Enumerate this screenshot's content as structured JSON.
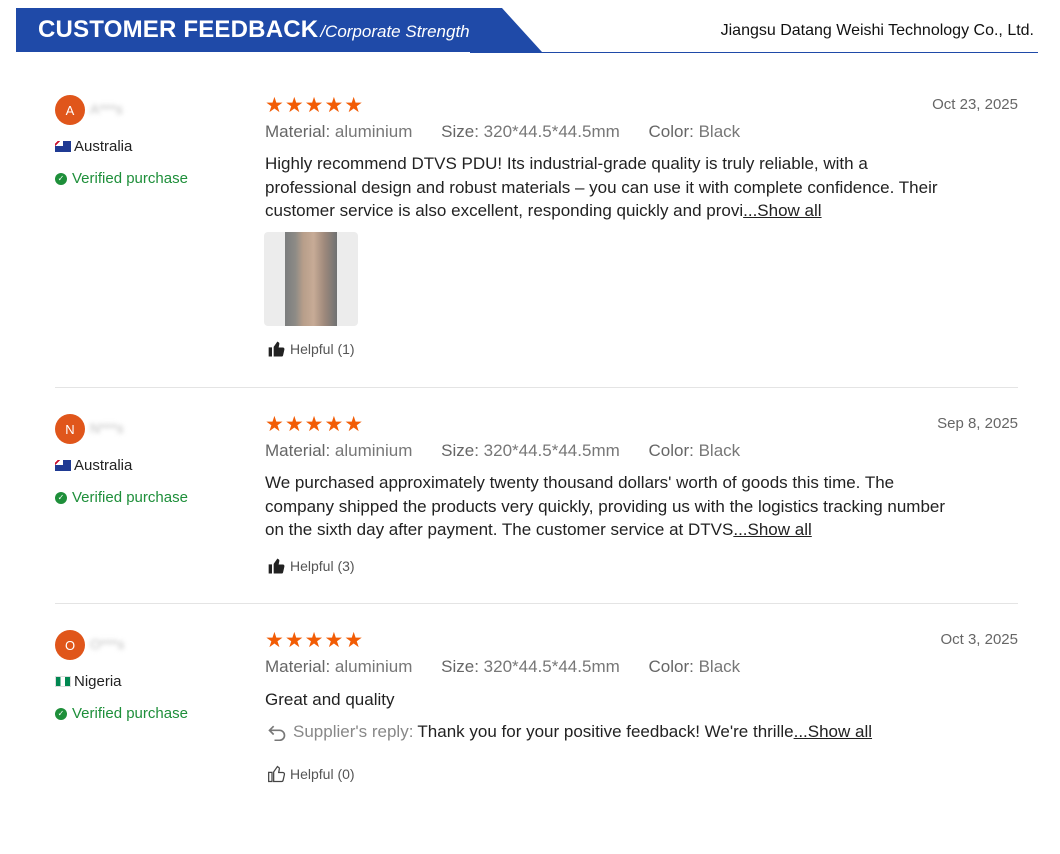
{
  "header": {
    "title": "CUSTOMER FEEDBACK",
    "subtitle": "/Corporate Strength",
    "company": "Jiangsu Datang Weishi Technology Co., Ltd."
  },
  "labels": {
    "material": "Material:",
    "size": "Size:",
    "color": "Color:",
    "verified": "Verified purchase",
    "show_all": "...Show all",
    "supplier_reply": "Supplier's reply:"
  },
  "reviews": [
    {
      "initial": "A",
      "username": "A***s",
      "country": "Australia",
      "stars": "★★★★★",
      "rating": 5,
      "date": "Oct 23, 2025",
      "material": "aluminium",
      "size": "320*44.5*44.5mm",
      "color": "Black",
      "text": "Highly recommend DTVS PDU! Its industrial-grade quality is truly reliable, with a professional design and robust materials – you can use it with complete confidence. Their customer service is also excellent, responding quickly and provi",
      "helpful": "Helpful (1)"
    },
    {
      "initial": "N",
      "username": "N***s",
      "country": "Australia",
      "stars": "★★★★★",
      "rating": 5,
      "date": "Sep 8, 2025",
      "material": "aluminium",
      "size": "320*44.5*44.5mm",
      "color": "Black",
      "text": "We purchased approximately twenty thousand dollars' worth of goods this time. The company shipped the products very quickly, providing us with the logistics tracking number on the sixth day after payment. The customer service at DTVS",
      "helpful": "Helpful (3)"
    },
    {
      "initial": "O",
      "username": "O***s",
      "country": "Nigeria",
      "stars": "★★★★★",
      "rating": 5,
      "date": "Oct 3, 2025",
      "material": "aluminium",
      "size": "320*44.5*44.5mm",
      "color": "Black",
      "text": "Great and quality",
      "reply": "Thank you for your positive feedback! We're thrille",
      "helpful": "Helpful (0)"
    }
  ]
}
